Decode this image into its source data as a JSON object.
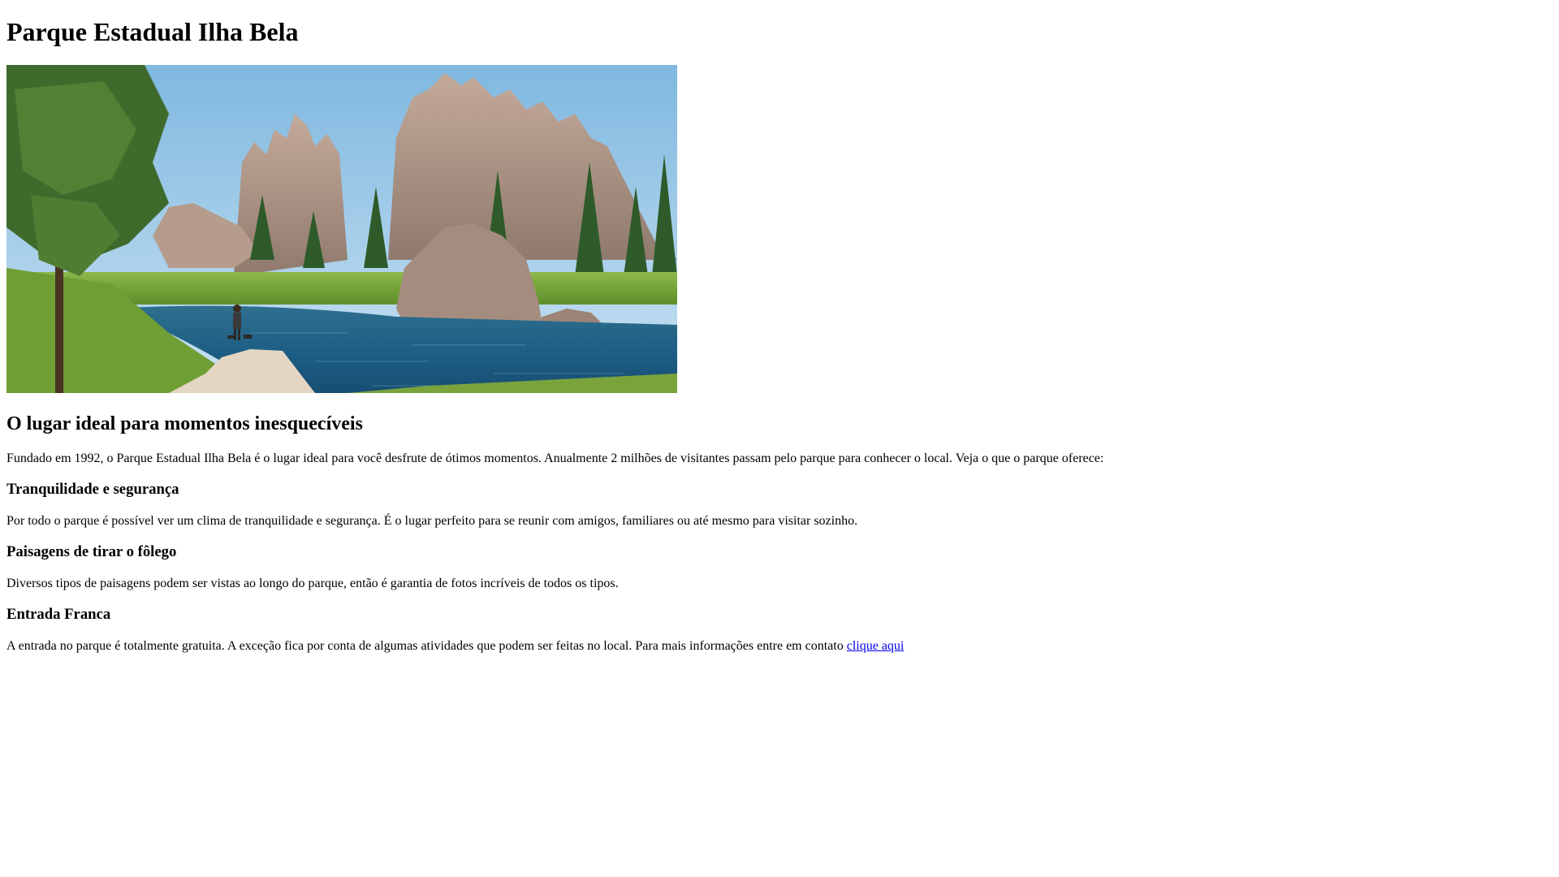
{
  "page": {
    "title": "Parque Estadual Ilha Bela",
    "hero_image_alt": "Parque Estadual Ilha Bela"
  },
  "intro": {
    "heading": "O lugar ideal para momentos inesquecíveis",
    "text": "Fundado em 1992, o Parque Estadual Ilha Bela é o lugar ideal para você desfrute de ótimos momentos. Anualmente 2 milhões de visitantes passam pelo parque para conhecer o local. Veja o que o parque oferece:"
  },
  "sections": [
    {
      "heading": "Tranquilidade e segurança",
      "text": "Por todo o parque é possível ver um clima de tranquilidade e segurança. É o lugar perfeito para se reunir com amigos, familiares ou até mesmo para visitar sozinho."
    },
    {
      "heading": "Paisagens de tirar o fôlego",
      "text": "Diversos tipos de paisagens podem ser vistas ao longo do parque, então é garantia de fotos incríveis de todos os tipos."
    },
    {
      "heading": "Entrada Franca",
      "text": "A entrada no parque é totalmente gratuita. A exceção fica por conta de algumas atividades que podem ser feitas no local. Para mais informações entre em contato ",
      "link_text": "clique aqui"
    }
  ],
  "colors": {
    "link": "#0000ee",
    "text": "#000000",
    "background": "#ffffff"
  }
}
